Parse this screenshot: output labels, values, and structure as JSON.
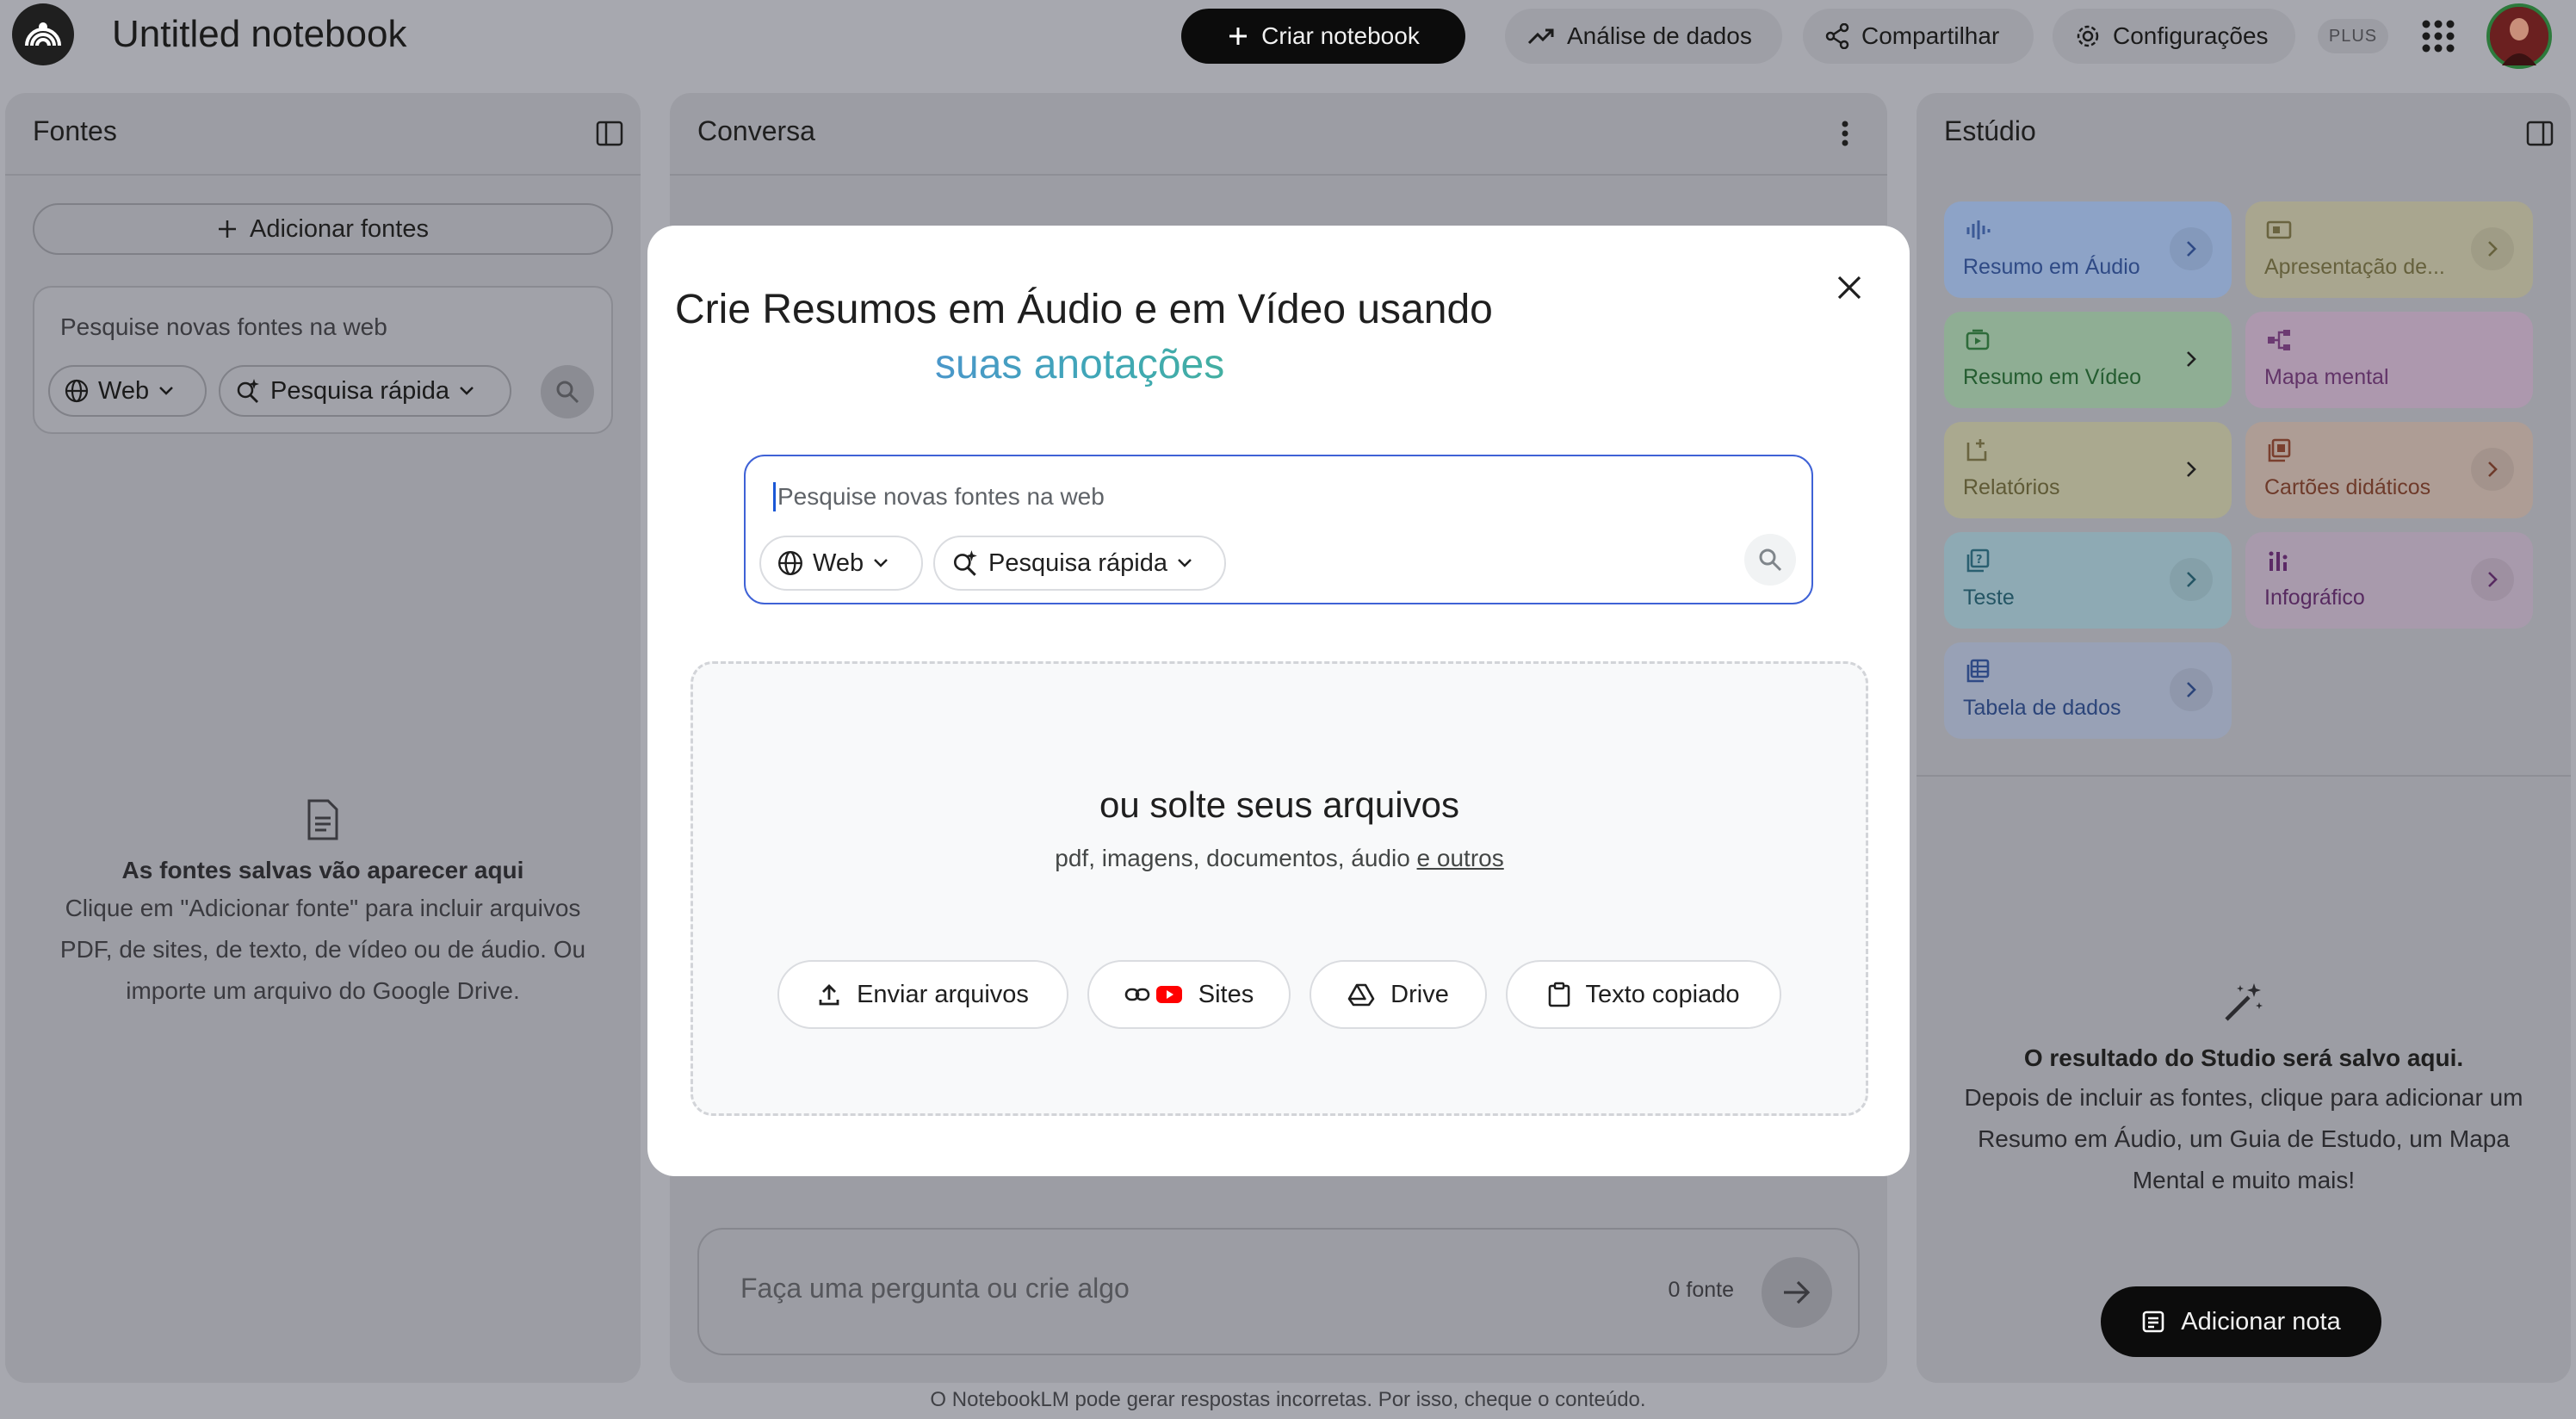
{
  "header": {
    "title": "Untitled notebook",
    "create_label": "Criar notebook",
    "analysis_label": "Análise de dados",
    "share_label": "Compartilhar",
    "settings_label": "Configurações",
    "plan_badge": "PLUS"
  },
  "sources": {
    "title": "Fontes",
    "add_label": "Adicionar fontes",
    "search_placeholder": "Pesquise novas fontes na web",
    "web_chip": "Web",
    "mode_chip": "Pesquisa rápida",
    "empty_title": "As fontes salvas vão aparecer aqui",
    "empty_text": "Clique em \"Adicionar fonte\" para incluir arquivos PDF, de sites, de texto, de vídeo ou de áudio. Ou importe um arquivo do Google Drive."
  },
  "chat": {
    "title": "Conversa",
    "input_placeholder": "Faça uma pergunta ou crie algo",
    "source_count": "0 fonte",
    "disclaimer": "O NotebookLM pode gerar respostas incorretas. Por isso, cheque o conteúdo."
  },
  "studio": {
    "title": "Estúdio",
    "cards": [
      {
        "label": "Resumo em Áudio",
        "icon": "audio-wave-icon",
        "color": "#8da3c7"
      },
      {
        "label": "Apresentação de...",
        "icon": "slides-icon",
        "color": "#a9a68f"
      },
      {
        "label": "Resumo em Vídeo",
        "icon": "video-icon",
        "color": "#8fae94"
      },
      {
        "label": "Mapa mental",
        "icon": "mind-map-icon",
        "color": "#ad98ae"
      },
      {
        "label": "Relatórios",
        "icon": "report-icon",
        "color": "#aaa98f"
      },
      {
        "label": "Cartões didáticos",
        "icon": "flashcards-icon",
        "color": "#ae9d95"
      },
      {
        "label": "Teste",
        "icon": "quiz-icon",
        "color": "#8eaab4"
      },
      {
        "label": "Infográfico",
        "icon": "infographic-icon",
        "color": "#a89aac"
      },
      {
        "label": "Tabela de dados",
        "icon": "table-icon",
        "color": "#98a1b6"
      }
    ],
    "empty_title": "O resultado do Studio será salvo aqui.",
    "empty_text": "Depois de incluir as fontes, clique para adicionar um Resumo em Áudio, um Guia de Estudo, um Mapa Mental e muito mais!",
    "add_note_label": "Adicionar nota"
  },
  "modal": {
    "title_line1": "Crie Resumos em Áudio e em Vídeo usando",
    "title_line2": "suas anotações",
    "search_placeholder": "Pesquise novas fontes na web",
    "web_chip": "Web",
    "mode_chip": "Pesquisa rápida",
    "drop_title": "ou solte seus arquivos",
    "drop_sub": "pdf, imagens, documentos, áudio",
    "drop_sub_link": "e outros",
    "upload_label": "Enviar arquivos",
    "sites_label": "Sites",
    "drive_label": "Drive",
    "paste_label": "Texto copiado"
  }
}
